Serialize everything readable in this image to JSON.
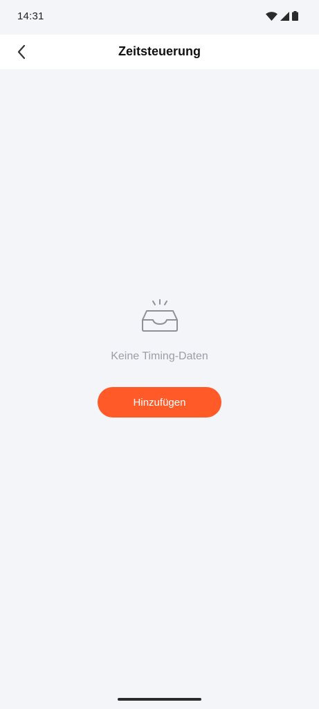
{
  "status_bar": {
    "time": "14:31",
    "icons": [
      "wifi-icon",
      "signal-icon",
      "battery-icon"
    ]
  },
  "header": {
    "back_icon": "chevron-left-icon",
    "title": "Zeitsteuerung"
  },
  "empty_state": {
    "icon": "empty-inbox-icon",
    "message": "Keine Timing-Daten",
    "add_button_label": "Hinzufügen"
  },
  "colors": {
    "accent": "#ff5a28",
    "background": "#f4f5f9",
    "header_background": "#ffffff",
    "muted_text": "#9a9da6"
  }
}
